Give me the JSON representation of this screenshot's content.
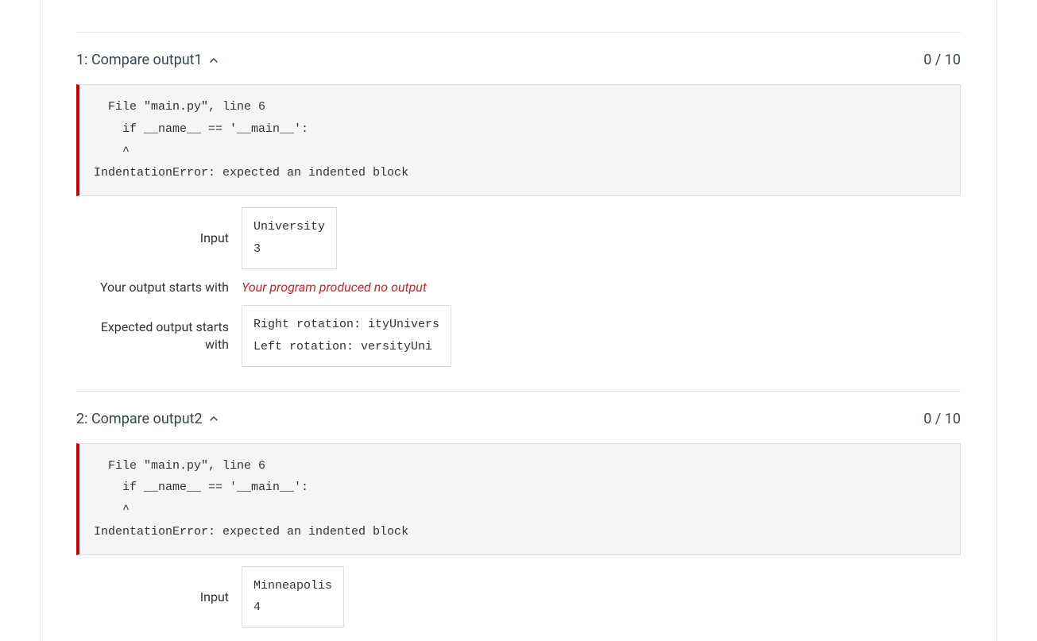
{
  "tests": [
    {
      "title": "1: Compare output1",
      "score": "0 / 10",
      "error": "  File \"main.py\", line 6\n    if __name__ == '__main__':\n    ^\nIndentationError: expected an indented block",
      "rows": [
        {
          "label": "Input",
          "kind": "code",
          "value": "University\n3"
        },
        {
          "label": "Your output starts with",
          "kind": "nooutput",
          "value": "Your program produced no output"
        },
        {
          "label": "Expected output starts with",
          "kind": "code",
          "value": "Right rotation: ityUnivers\nLeft rotation: versityUni"
        }
      ]
    },
    {
      "title": "2: Compare output2",
      "score": "0 / 10",
      "error": "  File \"main.py\", line 6\n    if __name__ == '__main__':\n    ^\nIndentationError: expected an indented block",
      "rows": [
        {
          "label": "Input",
          "kind": "code",
          "value": "Minneapolis\n4"
        }
      ]
    }
  ]
}
